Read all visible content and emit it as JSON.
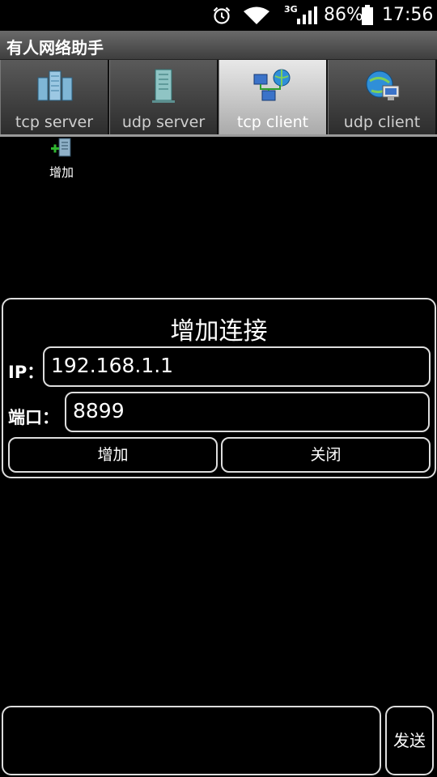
{
  "status_bar": {
    "network": "3G",
    "battery": "86%",
    "time": "17:56",
    "icons": [
      "alarm-icon",
      "wifi-icon",
      "signal-icon",
      "battery-icon"
    ]
  },
  "app": {
    "title": "有人网络助手"
  },
  "tabs": [
    {
      "label": "tcp server",
      "icon": "server-rack-icon",
      "active": false
    },
    {
      "label": "udp server",
      "icon": "server-tower-icon",
      "active": false
    },
    {
      "label": "tcp client",
      "icon": "network-computers-icon",
      "active": true
    },
    {
      "label": "udp client",
      "icon": "globe-computer-icon",
      "active": false
    }
  ],
  "toolbar": {
    "add_label": "增加",
    "add_icon": "add-server-icon"
  },
  "dialog": {
    "title": "增加连接",
    "ip_label": "IP：",
    "ip_value": "192.168.1.1",
    "port_label": "端口：",
    "port_value": "8899",
    "add_button": "增加",
    "close_button": "关闭"
  },
  "bottom": {
    "message_value": "",
    "send_button": "发送"
  }
}
